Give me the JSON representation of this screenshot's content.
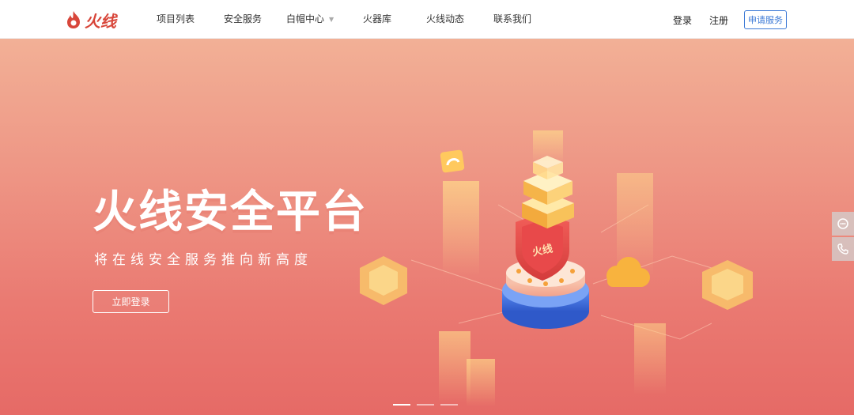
{
  "header": {
    "logo_text": "火线",
    "nav": [
      {
        "label": "项目列表"
      },
      {
        "label": "安全服务"
      },
      {
        "label": "白帽中心"
      },
      {
        "label": "火器库"
      },
      {
        "label": "火线动态"
      },
      {
        "label": "联系我们"
      }
    ],
    "login_label": "登录",
    "register_label": "注册",
    "apply_label": "申请服务"
  },
  "hero": {
    "title": "火线安全平台",
    "subtitle": "将在线安全服务推向新高度",
    "cta_label": "立即登录",
    "badge_text": "火线",
    "slider": {
      "count": 3,
      "active_index": 1
    }
  },
  "colors": {
    "brand": "#d8463a",
    "link_blue": "#3d7ad6",
    "hero_top": "#f2b096",
    "hero_bottom": "#e66a66"
  },
  "side_buttons": [
    {
      "icon": "chat-icon"
    },
    {
      "icon": "phone-icon"
    }
  ]
}
